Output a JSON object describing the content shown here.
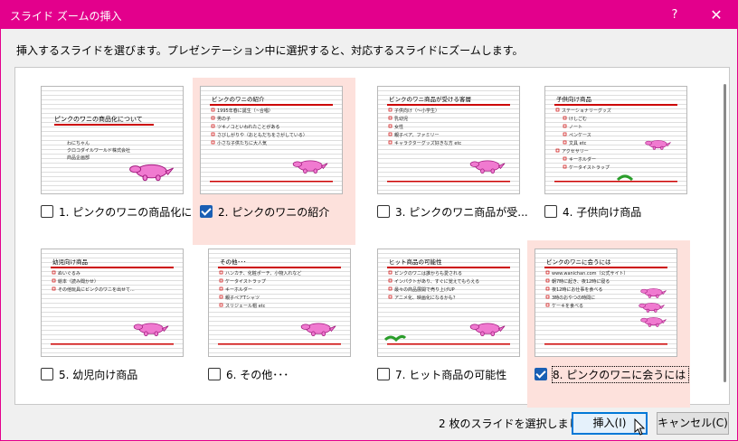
{
  "window": {
    "title": "スライド ズームの挿入",
    "help": "?",
    "close": "✕"
  },
  "instruction": "挿入するスライドを選びます。プレゼンテーション中に選択すると、対応するスライドにズームします。",
  "slides": [
    {
      "label": "1. ピンクのワニの商品化に...",
      "selected": false,
      "title": "ピンクのワニの商品化について",
      "lines": [
        "わにちゃん",
        "クロコダイルワールド株式会社",
        "商品企画部"
      ]
    },
    {
      "label": "2. ピンクのワニの紹介",
      "selected": true,
      "title": "ピンクのワニの紹介",
      "lines": [
        "1995年春に誕生（~合唱）",
        "男の子",
        "ツキノコといわれたことがある",
        "さびしがりや（おともだちをさがしている）",
        "小さな子供たちに大人気"
      ]
    },
    {
      "label": "3. ピンクのワニ商品が受...",
      "selected": false,
      "title": "ピンクのワニ商品が受ける客層",
      "lines": [
        "子供向け（～小学生）",
        "乳幼児",
        "女性",
        "親子ペア、ファミリー",
        "キャラクターグッズ好きな方 etc"
      ]
    },
    {
      "label": "4. 子供向け商品",
      "selected": false,
      "title": "子供向け商品",
      "lines": [
        "ステーショナリーグッズ",
        "けしごむ",
        "ノート",
        "ペンケース",
        "文具 etc",
        "アクセサリー",
        "キーホルダー",
        "ケータイストラップ"
      ]
    },
    {
      "label": "5. 幼児向け商品",
      "selected": false,
      "title": "幼児向け商品",
      "lines": [
        "ぬいぐるみ",
        "絵本（読み聞かせ）",
        "その他玩具にピンクのワニを出せて..."
      ]
    },
    {
      "label": "6. その他･･･",
      "selected": false,
      "title": "その他･･･",
      "lines": [
        "ハンカチ、化粧ポーチ、小物入れなど",
        "ケータイストラップ",
        "キーホルダー",
        "親子ペアTシャツ",
        "スリジェール帽 etc"
      ]
    },
    {
      "label": "7. ヒット商品の可能性",
      "selected": false,
      "title": "ヒット商品の可能性",
      "lines": [
        "ピンクのワニは誰からも愛される",
        "インパクトがあり、すぐに覚えてもらえる",
        "最々の商品展開で売り上げUP",
        "アニメ化、映画化になるかも？"
      ]
    },
    {
      "label": "8. ピンクのワニに会うには",
      "selected": true,
      "title": "ピンクのワニに会うには",
      "lines": [
        "www.wanichan.com（公式サイト）",
        "朝7時に起き、夜12時に寝る",
        "夜12時にお仕事を食べる",
        "3時のおやつの時間に",
        "ケーキを食べる"
      ]
    }
  ],
  "status_text": "2 枚のスライドを選択しました",
  "buttons": {
    "insert": "挿入(I)",
    "cancel": "キャンセル(C)"
  },
  "colors": {
    "accent": "#e3008c",
    "selection_bg": "#fde1dc",
    "checkbox": "#1a5fb4",
    "thumb_title_bar": "#cc0000",
    "croc": "#f07ad0"
  }
}
